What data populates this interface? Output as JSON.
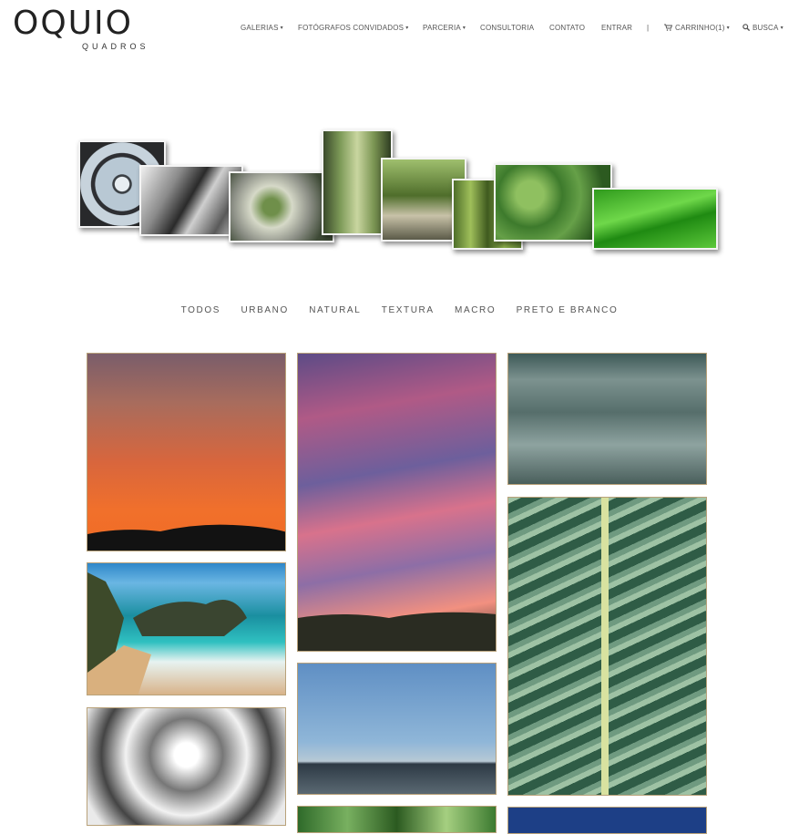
{
  "brand": {
    "name": "OQUIO",
    "tagline": "QUADROS"
  },
  "nav": {
    "items": [
      {
        "label": "GALERIAS",
        "caret": "▾"
      },
      {
        "label": "FOTÓGRAFOS CONVIDADOS",
        "caret": "▾"
      },
      {
        "label": "PARCERIA",
        "caret": "▾"
      },
      {
        "label": "CONSULTORIA",
        "caret": ""
      },
      {
        "label": "CONTATO",
        "caret": ""
      },
      {
        "label": "ENTRAR",
        "caret": ""
      }
    ],
    "separator": "|",
    "cart": {
      "label": "CARRINHO(1)",
      "caret": "▾",
      "icon": "cart-icon"
    },
    "search": {
      "label": "BUSCA",
      "caret": "▾",
      "icon": "search-icon"
    }
  },
  "filters": [
    "TODOS",
    "URBANO",
    "NATURAL",
    "TEXTURA",
    "MACRO",
    "PRETO E BRANCO"
  ],
  "colors": {
    "frame_border": "#b9a27a",
    "text_nav": "#555555",
    "logo": "#222222"
  }
}
